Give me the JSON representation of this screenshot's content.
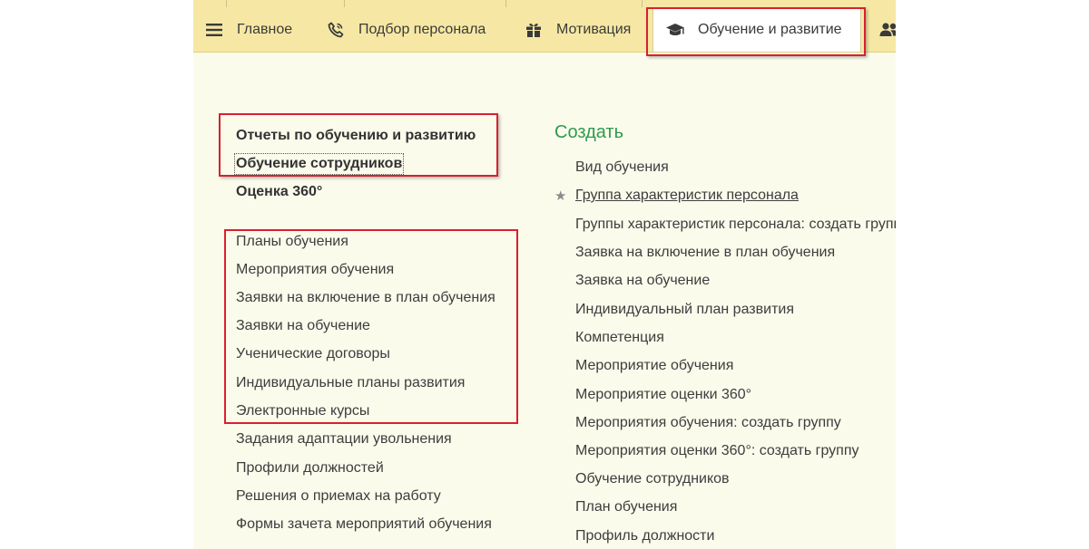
{
  "tabs": [
    {
      "label": "Главное",
      "icon": "menu-lines-icon"
    },
    {
      "label": "Подбор персонала",
      "icon": "phone-icon"
    },
    {
      "label": "Мотивация",
      "icon": "gift-icon"
    },
    {
      "label": "Обучение и развитие",
      "icon": "graduation-cap-icon",
      "active": true
    },
    {
      "label": "",
      "icon": "users-icon"
    }
  ],
  "reports": {
    "title": "Отчеты по обучению и развитию",
    "items": [
      "Обучение сотрудников",
      "Оценка 360°"
    ]
  },
  "nav_items": [
    "Планы обучения",
    "Мероприятия обучения",
    "Заявки на включение в план обучения",
    "Заявки на обучение",
    "Ученические договоры",
    "Индивидуальные планы развития",
    "Электронные курсы",
    "Задания адаптации увольнения",
    "Профили должностей",
    "Решения о приемах на работу",
    "Формы зачета мероприятий обучения"
  ],
  "create": {
    "title": "Создать",
    "items": [
      "Вид обучения",
      "Группа характеристик персонала",
      "Группы характеристик персонала: создать группу",
      "Заявка на включение в план обучения",
      "Заявка на обучение",
      "Индивидуальный план развития",
      "Компетенция",
      "Мероприятие обучения",
      "Мероприятие оценки 360°",
      "Мероприятия обучения: создать группу",
      "Мероприятия оценки 360°: создать группу",
      "Обучение сотрудников",
      "План обучения",
      "Профиль должности"
    ]
  },
  "colors": {
    "tabbar": "#f6e8a4",
    "background": "#fbfbec",
    "highlight": "#d9202f",
    "section_title": "#2d9b4d"
  }
}
